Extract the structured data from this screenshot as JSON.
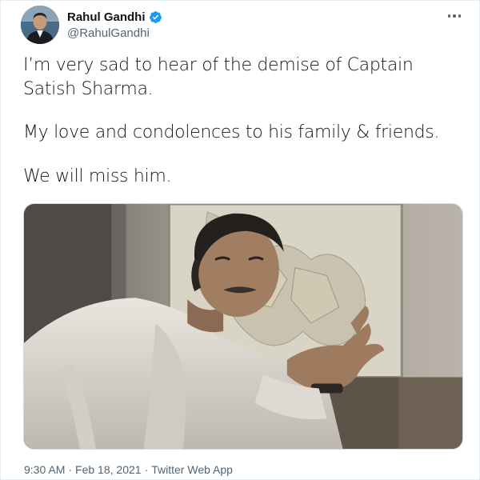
{
  "author": {
    "display_name": "Rahul Gandhi",
    "handle": "@RahulGandhi",
    "verified": true,
    "avatar_icon": "profile-photo"
  },
  "tweet": {
    "paragraphs": [
      "I’m very sad to hear of the demise of Captain Satish Sharma.",
      "My love and condolences to his family & friends.",
      "We will miss him."
    ]
  },
  "media": {
    "type": "photo",
    "description_icon": "news-photo"
  },
  "meta": {
    "time": "9:30 AM",
    "separator": "·",
    "date": "Feb 18, 2021",
    "source": "Twitter Web App"
  },
  "colors": {
    "text": "#0f1419",
    "secondary": "#536471",
    "verified": "#1d9bf0"
  }
}
